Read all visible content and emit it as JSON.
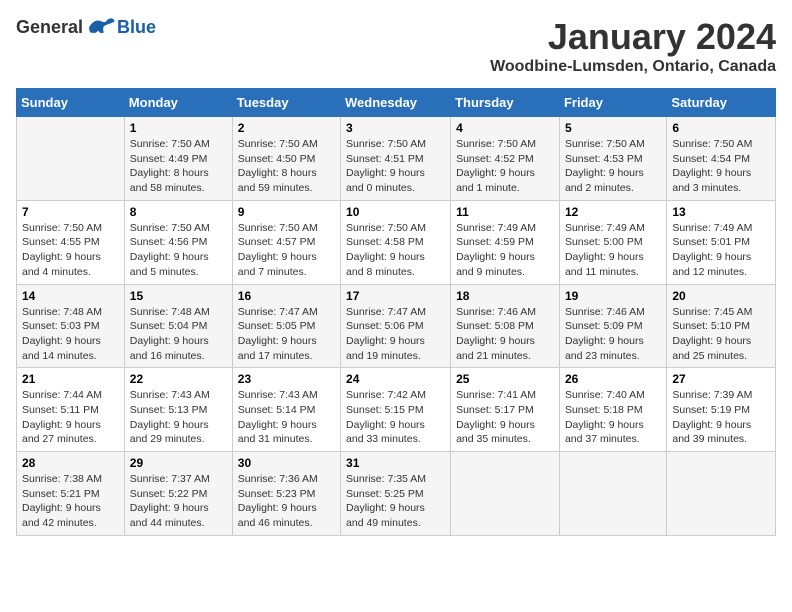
{
  "logo": {
    "general": "General",
    "blue": "Blue"
  },
  "title": "January 2024",
  "subtitle": "Woodbine-Lumsden, Ontario, Canada",
  "days_of_week": [
    "Sunday",
    "Monday",
    "Tuesday",
    "Wednesday",
    "Thursday",
    "Friday",
    "Saturday"
  ],
  "weeks": [
    [
      {
        "day": "",
        "sunrise": "",
        "sunset": "",
        "daylight": ""
      },
      {
        "day": "1",
        "sunrise": "Sunrise: 7:50 AM",
        "sunset": "Sunset: 4:49 PM",
        "daylight": "Daylight: 8 hours and 58 minutes."
      },
      {
        "day": "2",
        "sunrise": "Sunrise: 7:50 AM",
        "sunset": "Sunset: 4:50 PM",
        "daylight": "Daylight: 8 hours and 59 minutes."
      },
      {
        "day": "3",
        "sunrise": "Sunrise: 7:50 AM",
        "sunset": "Sunset: 4:51 PM",
        "daylight": "Daylight: 9 hours and 0 minutes."
      },
      {
        "day": "4",
        "sunrise": "Sunrise: 7:50 AM",
        "sunset": "Sunset: 4:52 PM",
        "daylight": "Daylight: 9 hours and 1 minute."
      },
      {
        "day": "5",
        "sunrise": "Sunrise: 7:50 AM",
        "sunset": "Sunset: 4:53 PM",
        "daylight": "Daylight: 9 hours and 2 minutes."
      },
      {
        "day": "6",
        "sunrise": "Sunrise: 7:50 AM",
        "sunset": "Sunset: 4:54 PM",
        "daylight": "Daylight: 9 hours and 3 minutes."
      }
    ],
    [
      {
        "day": "7",
        "sunrise": "Sunrise: 7:50 AM",
        "sunset": "Sunset: 4:55 PM",
        "daylight": "Daylight: 9 hours and 4 minutes."
      },
      {
        "day": "8",
        "sunrise": "Sunrise: 7:50 AM",
        "sunset": "Sunset: 4:56 PM",
        "daylight": "Daylight: 9 hours and 5 minutes."
      },
      {
        "day": "9",
        "sunrise": "Sunrise: 7:50 AM",
        "sunset": "Sunset: 4:57 PM",
        "daylight": "Daylight: 9 hours and 7 minutes."
      },
      {
        "day": "10",
        "sunrise": "Sunrise: 7:50 AM",
        "sunset": "Sunset: 4:58 PM",
        "daylight": "Daylight: 9 hours and 8 minutes."
      },
      {
        "day": "11",
        "sunrise": "Sunrise: 7:49 AM",
        "sunset": "Sunset: 4:59 PM",
        "daylight": "Daylight: 9 hours and 9 minutes."
      },
      {
        "day": "12",
        "sunrise": "Sunrise: 7:49 AM",
        "sunset": "Sunset: 5:00 PM",
        "daylight": "Daylight: 9 hours and 11 minutes."
      },
      {
        "day": "13",
        "sunrise": "Sunrise: 7:49 AM",
        "sunset": "Sunset: 5:01 PM",
        "daylight": "Daylight: 9 hours and 12 minutes."
      }
    ],
    [
      {
        "day": "14",
        "sunrise": "Sunrise: 7:48 AM",
        "sunset": "Sunset: 5:03 PM",
        "daylight": "Daylight: 9 hours and 14 minutes."
      },
      {
        "day": "15",
        "sunrise": "Sunrise: 7:48 AM",
        "sunset": "Sunset: 5:04 PM",
        "daylight": "Daylight: 9 hours and 16 minutes."
      },
      {
        "day": "16",
        "sunrise": "Sunrise: 7:47 AM",
        "sunset": "Sunset: 5:05 PM",
        "daylight": "Daylight: 9 hours and 17 minutes."
      },
      {
        "day": "17",
        "sunrise": "Sunrise: 7:47 AM",
        "sunset": "Sunset: 5:06 PM",
        "daylight": "Daylight: 9 hours and 19 minutes."
      },
      {
        "day": "18",
        "sunrise": "Sunrise: 7:46 AM",
        "sunset": "Sunset: 5:08 PM",
        "daylight": "Daylight: 9 hours and 21 minutes."
      },
      {
        "day": "19",
        "sunrise": "Sunrise: 7:46 AM",
        "sunset": "Sunset: 5:09 PM",
        "daylight": "Daylight: 9 hours and 23 minutes."
      },
      {
        "day": "20",
        "sunrise": "Sunrise: 7:45 AM",
        "sunset": "Sunset: 5:10 PM",
        "daylight": "Daylight: 9 hours and 25 minutes."
      }
    ],
    [
      {
        "day": "21",
        "sunrise": "Sunrise: 7:44 AM",
        "sunset": "Sunset: 5:11 PM",
        "daylight": "Daylight: 9 hours and 27 minutes."
      },
      {
        "day": "22",
        "sunrise": "Sunrise: 7:43 AM",
        "sunset": "Sunset: 5:13 PM",
        "daylight": "Daylight: 9 hours and 29 minutes."
      },
      {
        "day": "23",
        "sunrise": "Sunrise: 7:43 AM",
        "sunset": "Sunset: 5:14 PM",
        "daylight": "Daylight: 9 hours and 31 minutes."
      },
      {
        "day": "24",
        "sunrise": "Sunrise: 7:42 AM",
        "sunset": "Sunset: 5:15 PM",
        "daylight": "Daylight: 9 hours and 33 minutes."
      },
      {
        "day": "25",
        "sunrise": "Sunrise: 7:41 AM",
        "sunset": "Sunset: 5:17 PM",
        "daylight": "Daylight: 9 hours and 35 minutes."
      },
      {
        "day": "26",
        "sunrise": "Sunrise: 7:40 AM",
        "sunset": "Sunset: 5:18 PM",
        "daylight": "Daylight: 9 hours and 37 minutes."
      },
      {
        "day": "27",
        "sunrise": "Sunrise: 7:39 AM",
        "sunset": "Sunset: 5:19 PM",
        "daylight": "Daylight: 9 hours and 39 minutes."
      }
    ],
    [
      {
        "day": "28",
        "sunrise": "Sunrise: 7:38 AM",
        "sunset": "Sunset: 5:21 PM",
        "daylight": "Daylight: 9 hours and 42 minutes."
      },
      {
        "day": "29",
        "sunrise": "Sunrise: 7:37 AM",
        "sunset": "Sunset: 5:22 PM",
        "daylight": "Daylight: 9 hours and 44 minutes."
      },
      {
        "day": "30",
        "sunrise": "Sunrise: 7:36 AM",
        "sunset": "Sunset: 5:23 PM",
        "daylight": "Daylight: 9 hours and 46 minutes."
      },
      {
        "day": "31",
        "sunrise": "Sunrise: 7:35 AM",
        "sunset": "Sunset: 5:25 PM",
        "daylight": "Daylight: 9 hours and 49 minutes."
      },
      {
        "day": "",
        "sunrise": "",
        "sunset": "",
        "daylight": ""
      },
      {
        "day": "",
        "sunrise": "",
        "sunset": "",
        "daylight": ""
      },
      {
        "day": "",
        "sunrise": "",
        "sunset": "",
        "daylight": ""
      }
    ]
  ]
}
